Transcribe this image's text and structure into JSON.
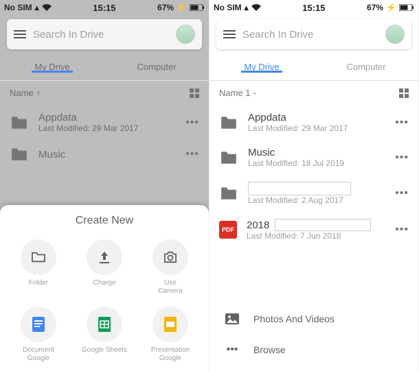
{
  "status": {
    "carrier": "No SIM",
    "time": "15:15",
    "battery": "67%"
  },
  "search": {
    "placeholder": "Search In Drive"
  },
  "tabs": {
    "my_drive": "My Drive",
    "computer": "Computer"
  },
  "sort": {
    "label_left": "Name",
    "label_right": "Name 1"
  },
  "folders": {
    "appdata": {
      "name": "Appdata",
      "meta": "Last Modified: 29 Mar 2017"
    },
    "music_left": {
      "name": "Music"
    },
    "music_right": {
      "name": "Music",
      "meta": "Last Modified: 18 Jul 2019"
    },
    "redacted": {
      "meta": "Last Modified: 2 Aug 2017"
    },
    "pdf2018": {
      "name": "2018",
      "meta": "Last Modified: 7 Jun 2018"
    }
  },
  "pdf_badge": "PDF",
  "create_sheet": {
    "title": "Create New",
    "items": {
      "folder": "Folder",
      "upload": "Charge",
      "camera": "Use\nCamera",
      "doc": "Document\nGoogle",
      "sheets": "Google Sheets",
      "slides": "Presentation\nGoogle"
    }
  },
  "bottom_menu": {
    "photos": "Photos And Videos",
    "browse": "Browse"
  },
  "colors": {
    "accent": "#4285f4",
    "docs": "#4285f4",
    "sheets": "#0f9d58",
    "slides": "#f4b400",
    "pdf": "#d93025"
  }
}
